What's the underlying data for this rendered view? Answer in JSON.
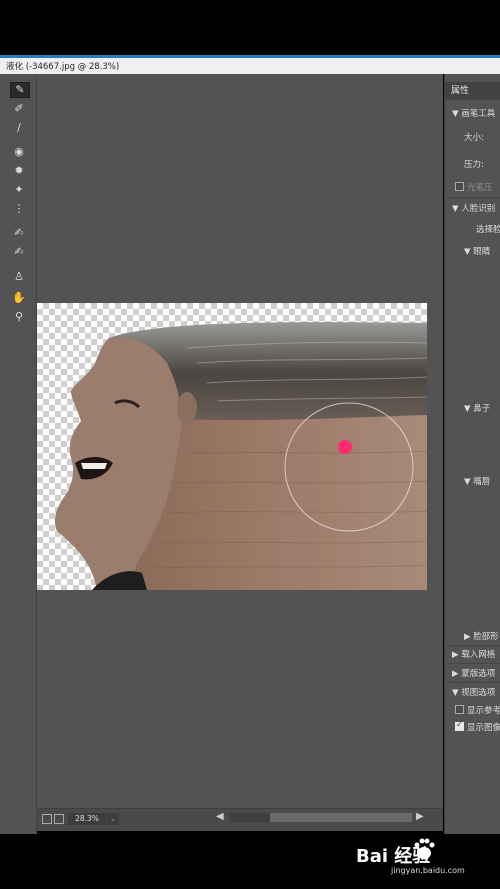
{
  "window": {
    "title": "液化 (-34667.jpg @ 28.3%)"
  },
  "tools": [
    {
      "name": "forward-warp-tool-icon",
      "glyph": "✎",
      "active": true
    },
    {
      "name": "reconstruct-tool-icon",
      "glyph": "✐"
    },
    {
      "name": "smooth-tool-icon",
      "glyph": "∕"
    },
    {
      "name": "twirl-tool-icon",
      "glyph": "◉"
    },
    {
      "name": "pucker-tool-icon",
      "glyph": "✹"
    },
    {
      "name": "bloat-tool-icon",
      "glyph": "✦"
    },
    {
      "name": "push-left-tool-icon",
      "glyph": "⋮"
    },
    {
      "name": "freeze-mask-tool-icon",
      "glyph": "✍"
    },
    {
      "name": "thaw-mask-tool-icon",
      "glyph": "✍"
    },
    {
      "name": "face-tool-icon",
      "glyph": "♙"
    },
    {
      "name": "hand-tool-icon",
      "glyph": "✋"
    },
    {
      "name": "zoom-tool-icon",
      "glyph": "⚲"
    }
  ],
  "panel": {
    "header": "属性",
    "brush_section": "画笔工具",
    "size_label": "大小:",
    "pressure_label": "压力:",
    "stylus_label": "光笔压",
    "face_section": "人脸识别",
    "select_face": "选择脸",
    "eyes": "眼睛",
    "nose": "鼻子",
    "mouth": "嘴唇",
    "face_shape": "脸部形",
    "load_mesh": "载入网格",
    "mask_options": "蒙版选项",
    "view_options": "视图选项",
    "show_guides": "显示参考",
    "show_image": "显示图像",
    "show_guides_checked": false,
    "show_image_checked": true
  },
  "bottom": {
    "zoom": "28.3%"
  },
  "watermark": {
    "logo": "Bai 经验",
    "url": "jingyan.baidu.com"
  }
}
